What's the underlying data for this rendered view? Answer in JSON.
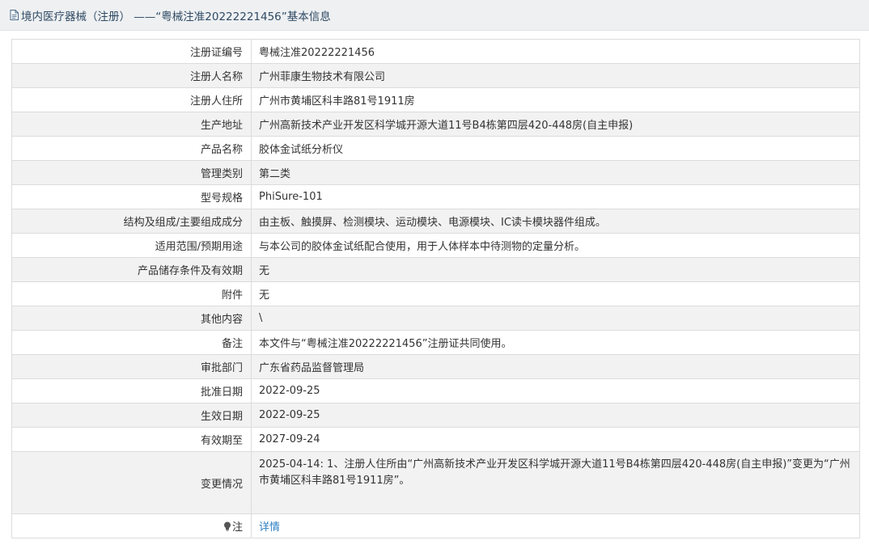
{
  "header": {
    "title": "境内医疗器械（注册） ——“粤械注准20222221456”基本信息",
    "icon": "document-icon"
  },
  "rows": [
    {
      "label": "注册证编号",
      "value": "粤械注准20222221456"
    },
    {
      "label": "注册人名称",
      "value": "广州菲康生物技术有限公司"
    },
    {
      "label": "注册人住所",
      "value": "广州市黄埔区科丰路81号1911房"
    },
    {
      "label": "生产地址",
      "value": "广州高新技术产业开发区科学城开源大道11号B4栋第四层420-448房(自主申报)"
    },
    {
      "label": "产品名称",
      "value": "胶体金试纸分析仪"
    },
    {
      "label": "管理类别",
      "value": "第二类"
    },
    {
      "label": "型号规格",
      "value": "PhiSure-101"
    },
    {
      "label": "结构及组成/主要组成成分",
      "value": "由主板、触摸屏、检测模块、运动模块、电源模块、IC读卡模块器件组成。"
    },
    {
      "label": "适用范围/预期用途",
      "value": "与本公司的胶体金试纸配合使用，用于人体样本中待测物的定量分析。"
    },
    {
      "label": "产品储存条件及有效期",
      "value": "无"
    },
    {
      "label": "附件",
      "value": "无"
    },
    {
      "label": "其他内容",
      "value": "\\"
    },
    {
      "label": "备注",
      "value": "本文件与“粤械注准20222221456”注册证共同使用。"
    },
    {
      "label": "审批部门",
      "value": "广东省药品监督管理局"
    },
    {
      "label": "批准日期",
      "value": "2022-09-25"
    },
    {
      "label": "生效日期",
      "value": "2022-09-25"
    },
    {
      "label": "有效期至",
      "value": "2027-09-24"
    },
    {
      "label": "变更情况",
      "value": "2025-04-14: 1、注册人住所由“广州高新技术产业开发区科学城开源大道11号B4栋第四层420-448房(自主申报)”变更为“广州市黄埔区科丰路81号1911房”。"
    }
  ],
  "note": {
    "label": "注",
    "icon": "lightbulb-icon",
    "link_text": "详情"
  },
  "colors": {
    "header_bg": "#eef0f2",
    "header_text": "#2f4a63",
    "row_alt_bg": "#f2f2f2",
    "border": "#dcdcdc",
    "link": "#2a7fc4"
  }
}
